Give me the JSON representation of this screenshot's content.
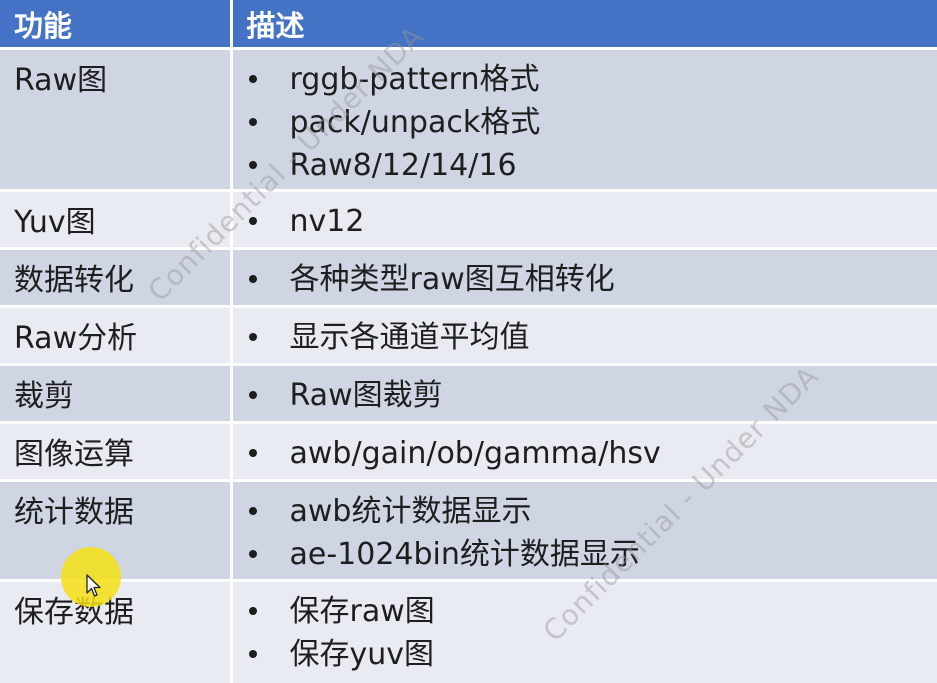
{
  "table": {
    "header": {
      "feature": "功能",
      "description": "描述"
    },
    "rows": [
      {
        "feature": "Raw图",
        "items": [
          "rggb-pattern格式",
          "pack/unpack格式",
          "Raw8/12/14/16"
        ]
      },
      {
        "feature": "Yuv图",
        "items": [
          "nv12"
        ]
      },
      {
        "feature": "数据转化",
        "items": [
          "各种类型raw图互相转化"
        ]
      },
      {
        "feature": "Raw分析",
        "items": [
          "显示各通道平均值"
        ]
      },
      {
        "feature": "裁剪",
        "items": [
          "Raw图裁剪"
        ]
      },
      {
        "feature": "图像运算",
        "items": [
          "awb/gain/ob/gamma/hsv"
        ]
      },
      {
        "feature": "统计数据",
        "items": [
          "awb统计数据显示",
          "ae-1024bin统计数据显示"
        ]
      },
      {
        "feature": "保存数据",
        "items": [
          "保存raw图",
          "保存yuv图"
        ]
      }
    ]
  },
  "watermark": {
    "text": "Confidential - Under NDA"
  },
  "colors": {
    "header_bg": "#4472c4",
    "row_dark": "#cfd5e3",
    "row_light": "#e8ebf2",
    "cursor_highlight": "#f5e114"
  }
}
